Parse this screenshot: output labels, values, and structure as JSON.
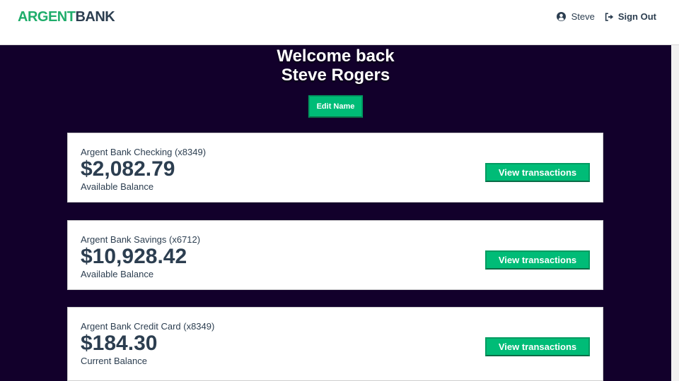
{
  "nav": {
    "logo_part1": "ARGENT",
    "logo_part2": "BANK",
    "user_name": "Steve",
    "sign_out": "Sign Out",
    "icons": {
      "user": "user-circle-icon",
      "sign_out": "sign-out-icon"
    }
  },
  "header": {
    "line1": "Welcome back",
    "line2": "Steve Rogers",
    "edit_button": "Edit Name"
  },
  "accounts": [
    {
      "title": "Argent Bank Checking (x8349)",
      "amount": "$2,082.79",
      "description": "Available Balance",
      "button": "View transactions"
    },
    {
      "title": "Argent Bank Savings (x6712)",
      "amount": "$10,928.42",
      "description": "Available Balance",
      "button": "View transactions"
    },
    {
      "title": "Argent Bank Credit Card (x8349)",
      "amount": "$184.30",
      "description": "Current Balance",
      "button": "View transactions"
    }
  ],
  "colors": {
    "brand_green": "#00bc77",
    "logo_green": "#1fad6b",
    "text_dark": "#2c3e50",
    "background_dark": "#12002b"
  }
}
